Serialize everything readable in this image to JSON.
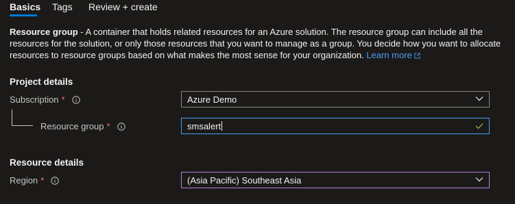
{
  "tabs": [
    {
      "label": "Basics"
    },
    {
      "label": "Tags"
    },
    {
      "label": "Review + create"
    }
  ],
  "description": {
    "term": "Resource group",
    "text": " - A container that holds related resources for an Azure solution. The resource group can include all the resources for the solution, or only those resources that you want to manage as a group. You decide how you want to allocate resources to resource groups based on what makes the most sense for your organization. ",
    "link": "Learn more"
  },
  "project_details": {
    "title": "Project details",
    "subscription": {
      "label": "Subscription",
      "required_mark": "*",
      "value": "Azure Demo"
    },
    "resource_group": {
      "label": "Resource group",
      "required_mark": "*",
      "value": "smsalert"
    }
  },
  "resource_details": {
    "title": "Resource details",
    "region": {
      "label": "Region",
      "required_mark": "*",
      "value": "(Asia Pacific) Southeast Asia"
    }
  },
  "colors": {
    "background": "#1b1a19",
    "accent": "#0078d4",
    "link": "#479ef5",
    "required": "#f1707b",
    "valid": "#92c353",
    "region_border": "#b87fe0"
  },
  "icons": {
    "info": "info-icon",
    "chevron": "chevron-down-icon",
    "check": "checkmark-icon",
    "external": "external-link-icon"
  }
}
